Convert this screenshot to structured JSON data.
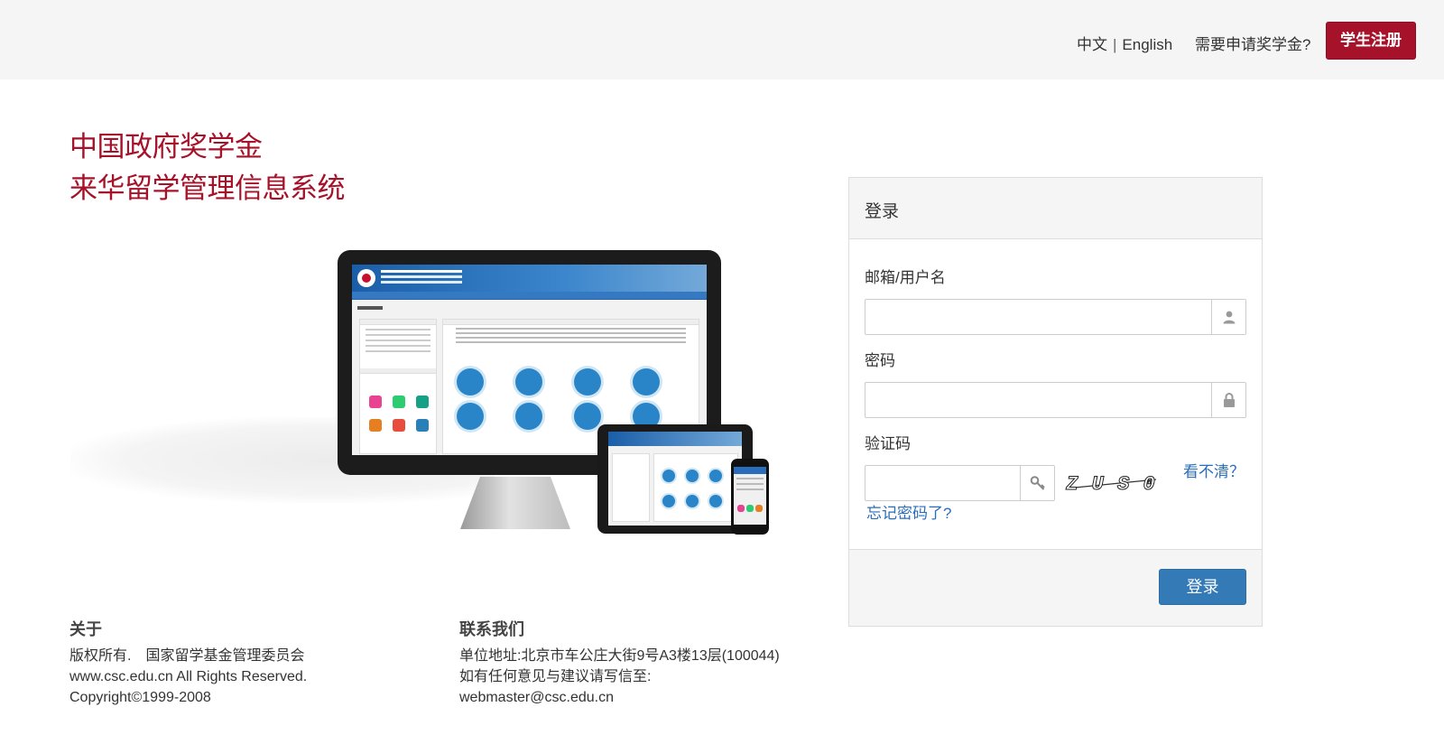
{
  "topbar": {
    "lang_zh": "中文",
    "lang_separator": "|",
    "lang_en": "English",
    "need_scholarship_link": "需要申请奖学金?",
    "register_button": "学生注册",
    "register_color": "#a6122a"
  },
  "title": {
    "line1": "中国政府奖学金",
    "line2": "来华留学管理信息系统",
    "color": "#a6122a"
  },
  "login": {
    "header": "登录",
    "username_label": "邮箱/用户名",
    "username_value": "",
    "password_label": "密码",
    "password_value": "",
    "captcha_label": "验证码",
    "captcha_value": "",
    "captcha_image_text": "Z U S 0",
    "refresh_link": "看不清？",
    "forgot_link": "忘记密码了?",
    "submit_button": "登录",
    "submit_color": "#337ab7",
    "icons": {
      "username": "user-icon",
      "password": "lock-icon",
      "captcha": "key-icon"
    }
  },
  "footer": {
    "about": {
      "heading": "关于",
      "line1": "版权所有.　国家留学基金管理委员会",
      "line2": "www.csc.edu.cn All Rights Reserved.",
      "line3": "Copyright©1999-2008"
    },
    "contact": {
      "heading": "联系我们",
      "line1": "单位地址:北京市车公庄大街9号A3楼13层(100044)",
      "line2": "如有任何意见与建议请写信至:",
      "line3": "webmaster@csc.edu.cn"
    }
  }
}
